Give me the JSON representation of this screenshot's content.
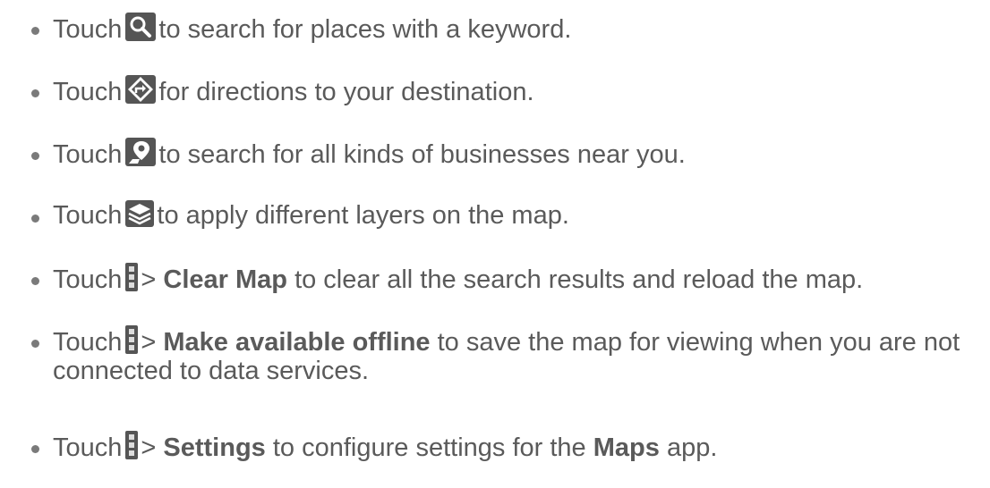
{
  "items": [
    {
      "pre": "Touch",
      "icon": "search-icon",
      "post": "to search for places with a keyword."
    },
    {
      "pre": "Touch",
      "icon": "directions-icon",
      "post": "for directions to your destination."
    },
    {
      "pre": "Touch",
      "icon": "local-places-icon",
      "post": "to search for all kinds of businesses near you."
    },
    {
      "pre": "Touch",
      "icon": "layers-icon",
      "post": "to apply different layers on the map."
    },
    {
      "pre": "Touch",
      "icon": "menu-icon",
      "sep": ">",
      "bold": "Clear Map",
      "post": "to clear all the search results and reload the map."
    },
    {
      "pre": "Touch",
      "icon": "menu-icon",
      "sep": ">",
      "bold": "Make available offline",
      "post": "to save the map for viewing when you are not",
      "post2": "connected to data services."
    },
    {
      "pre": "Touch",
      "icon": "menu-icon",
      "sep": ">",
      "bold": "Settings",
      "post": "to configure settings for the",
      "bold2": "Maps",
      "post3": "app."
    }
  ],
  "colors": {
    "text": "#5a5a5a",
    "icon_bg": "#555555",
    "icon_fg": "#ffffff"
  }
}
